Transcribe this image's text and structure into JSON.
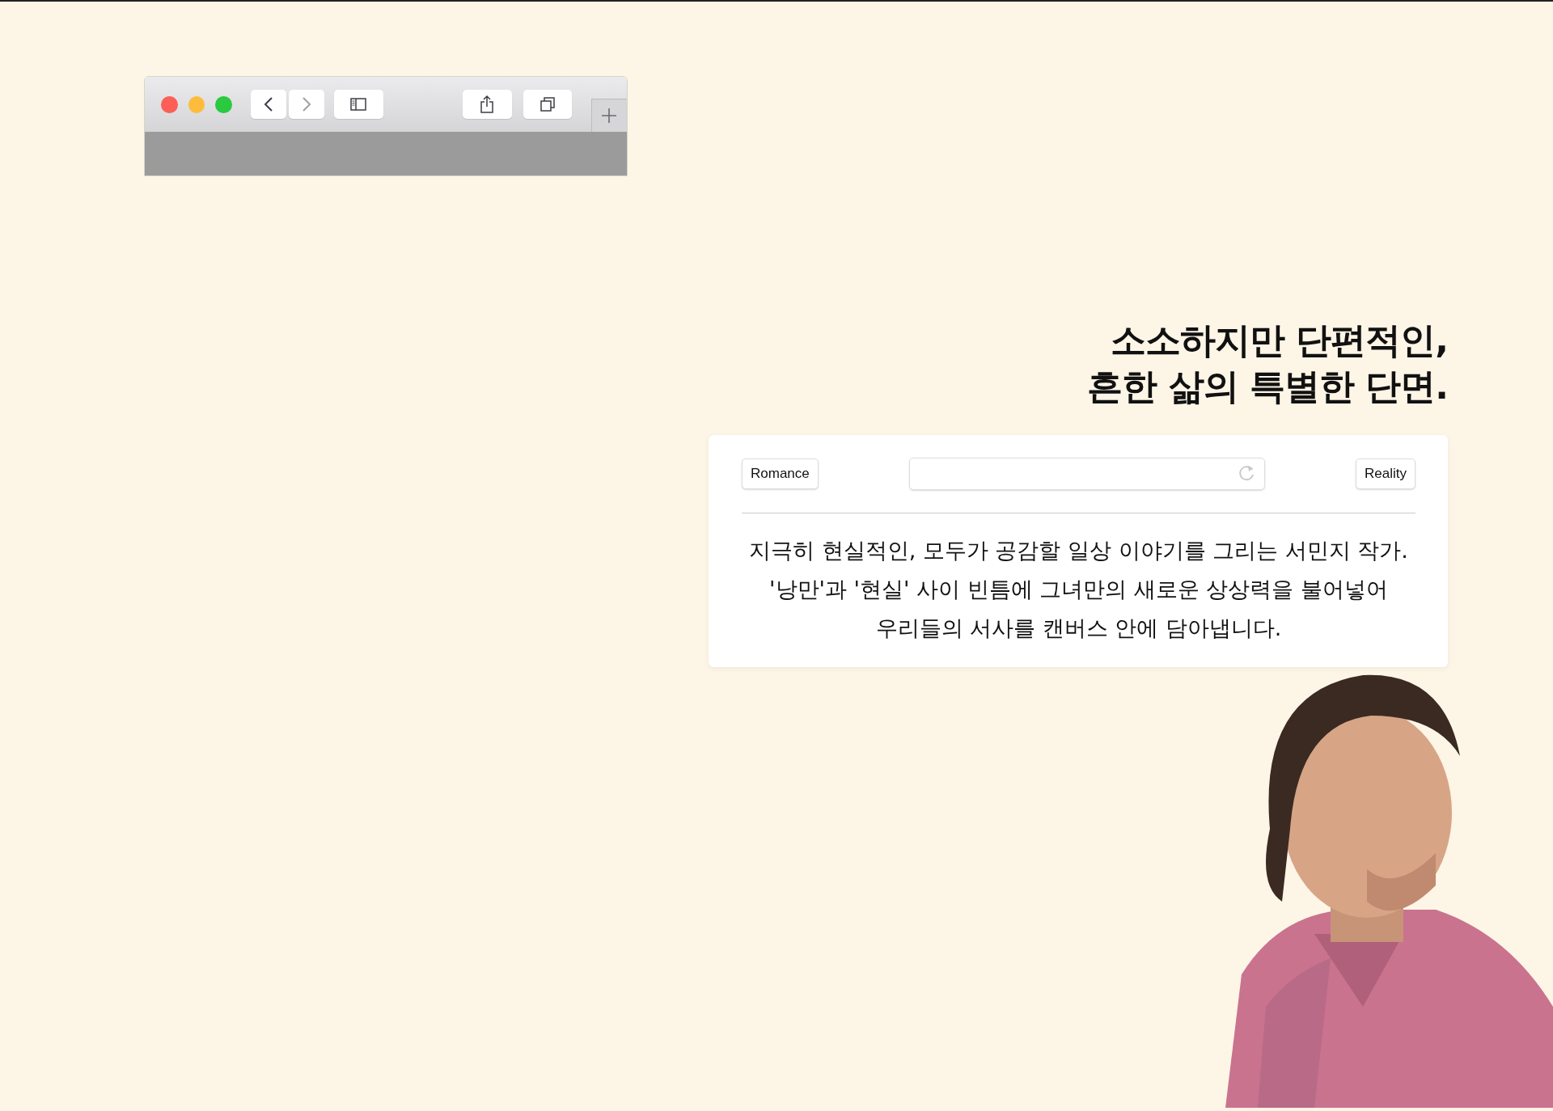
{
  "browser": {
    "traffic_lights": [
      {
        "color": "#fc5f58"
      },
      {
        "color": "#fdbc3b"
      },
      {
        "color": "#2ac940"
      }
    ],
    "toolbar_buttons": [
      {
        "kind": "back",
        "disabled": false
      },
      {
        "kind": "forward",
        "disabled": true
      },
      {
        "kind": "sidebar",
        "disabled": false
      },
      {
        "kind": "share",
        "disabled": false
      },
      {
        "kind": "tabs",
        "disabled": false
      }
    ],
    "new_tab": {
      "kind": "plus"
    }
  },
  "headline": [
    "소소하지만 단편적인,",
    "흔한 삶의 특별한 단면."
  ],
  "card": {
    "left_button": "Romance",
    "right_button": "Reality",
    "field": {
      "kind": "reload"
    },
    "paragraph": [
      "지극히 현실적인, 모두가 공감할 일상 이야기를 그리는 서민지 작가.",
      "'낭만'과 '현실' 사이 빈틈에 그녀만의 새로운 상상력을 불어넣어",
      "우리들의 서사를 캔버스 안에 담아냅니다."
    ]
  },
  "portrait": {
    "kind": "picture"
  }
}
